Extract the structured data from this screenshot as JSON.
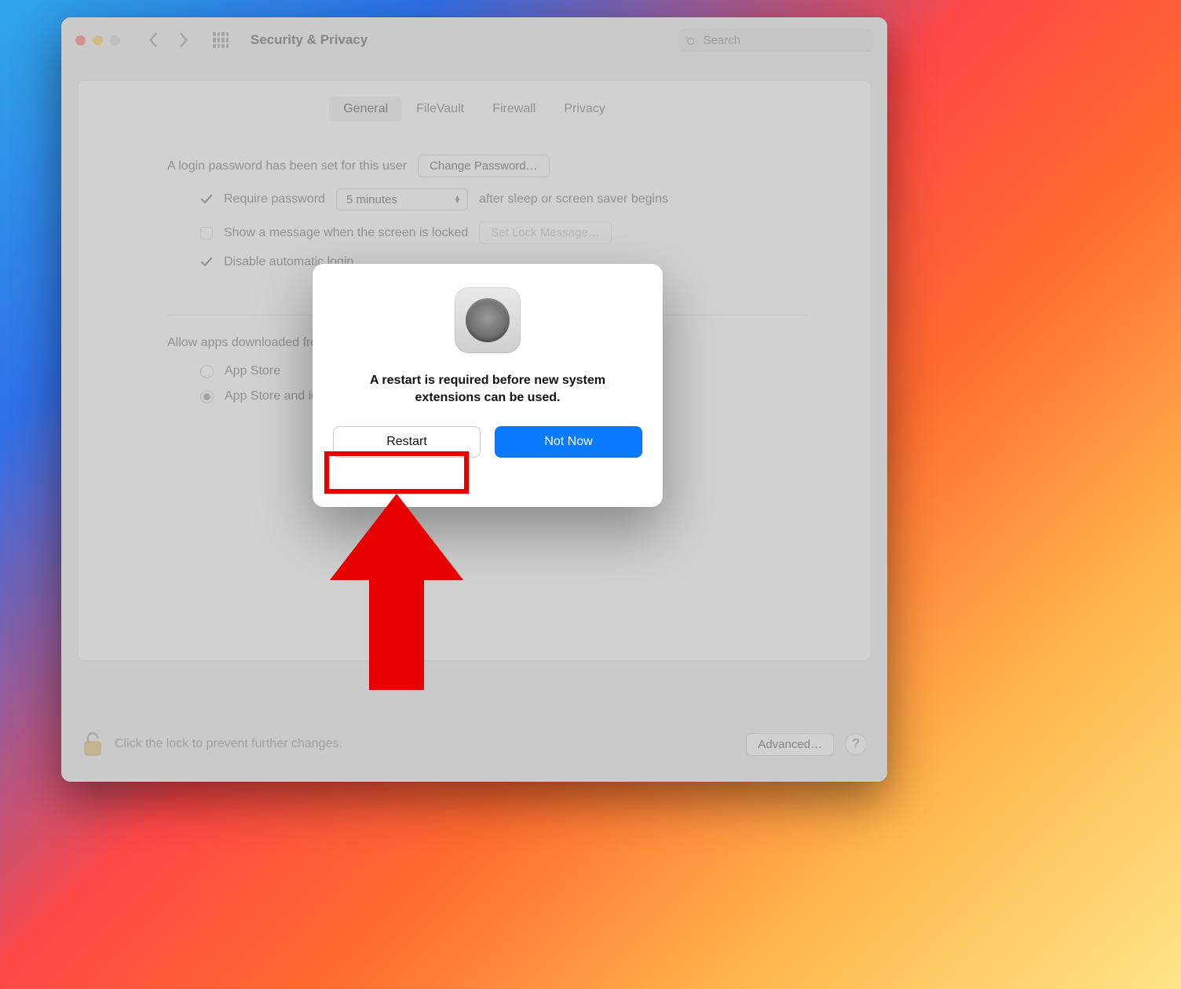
{
  "toolbar": {
    "title": "Security & Privacy",
    "search_placeholder": "Search"
  },
  "tabs": [
    {
      "label": "General",
      "active": true
    },
    {
      "label": "FileVault",
      "active": false
    },
    {
      "label": "Firewall",
      "active": false
    },
    {
      "label": "Privacy",
      "active": false
    }
  ],
  "general": {
    "login_password_text": "A login password has been set for this user",
    "change_password_label": "Change Password…",
    "require_password_label": "Require password",
    "require_password_delay": "5 minutes",
    "require_password_suffix": "after sleep or screen saver begins",
    "show_message_label": "Show a message when the screen is locked",
    "set_lock_message_label": "Set Lock Message…",
    "disable_auto_login_label": "Disable automatic login"
  },
  "allow": {
    "title": "Allow apps downloaded from:",
    "options": [
      {
        "label": "App Store",
        "selected": false
      },
      {
        "label": "App Store and identified developers",
        "selected": true
      }
    ]
  },
  "footer": {
    "lock_text": "Click the lock to prevent further changes.",
    "advanced_label": "Advanced…",
    "help_label": "?"
  },
  "modal": {
    "message": "A restart is required before new system extensions can be used.",
    "restart_label": "Restart",
    "notnow_label": "Not Now"
  },
  "annotation": {
    "highlight_target": "restart-button"
  }
}
